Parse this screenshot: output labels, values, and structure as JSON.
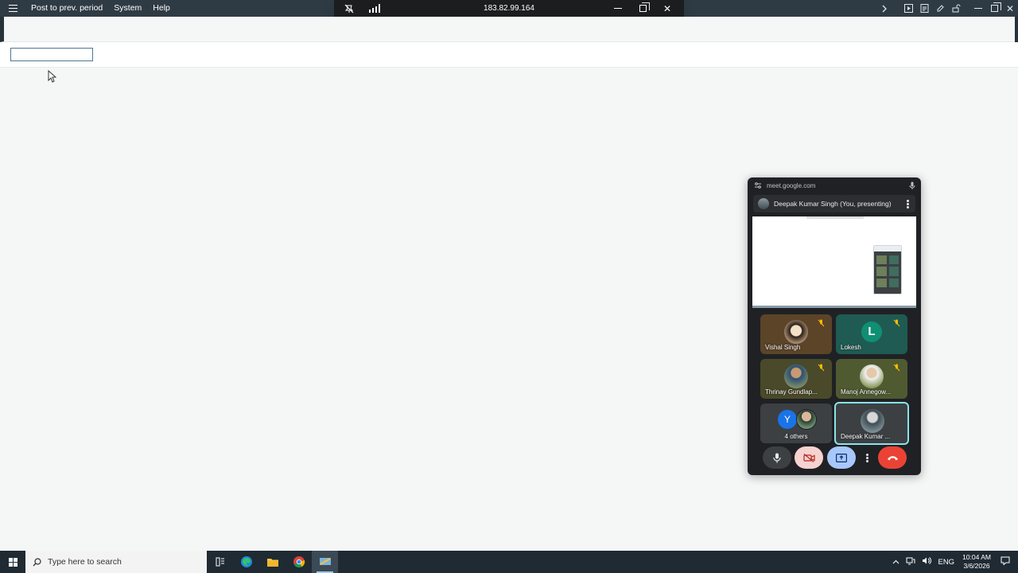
{
  "app": {
    "menu": [
      "Post to prev. period",
      "System",
      "Help"
    ],
    "text_field_value": ""
  },
  "remote_session": {
    "ip": "183.82.99.164"
  },
  "meet": {
    "url": "meet.google.com",
    "presenter": "Deepak Kumar Singh (You, presenting)",
    "tiles": [
      {
        "name": "Vishal Singh",
        "muted": true
      },
      {
        "name": "Lokesh",
        "initial": "L",
        "muted": true
      },
      {
        "name": "Thrinay Gundlap...",
        "muted": true
      },
      {
        "name": "Manoj Annegow...",
        "muted": true
      },
      {
        "name": "4 others",
        "initial": "Y"
      },
      {
        "name": "Deepak Kumar ..."
      }
    ],
    "colors": {
      "hangup": "#ea4335",
      "present": "#a8c7fa",
      "camera_off": "#f6d2d0",
      "active_border": "#8ae3e8"
    }
  },
  "taskbar": {
    "search_placeholder": "Type here to search",
    "lang": "ENG",
    "time": "10:04 AM",
    "date": "3/6/2026"
  }
}
